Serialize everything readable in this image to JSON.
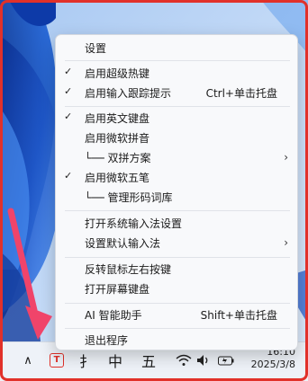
{
  "menu": {
    "items": [
      {
        "label": "设置",
        "checked": false,
        "shortcut": "",
        "submenu": false
      },
      {
        "label": "启用超级热键",
        "checked": true,
        "shortcut": "",
        "submenu": false
      },
      {
        "label": "启用输入跟踪提示",
        "checked": true,
        "shortcut": "Ctrl+单击托盘",
        "submenu": false
      },
      {
        "label": "启用英文键盘",
        "checked": true,
        "shortcut": "",
        "submenu": false
      },
      {
        "label": "启用微软拼音",
        "checked": false,
        "shortcut": "",
        "submenu": false
      },
      {
        "label": "└── 双拼方案",
        "checked": false,
        "shortcut": "",
        "submenu": true
      },
      {
        "label": "启用微软五笔",
        "checked": true,
        "shortcut": "",
        "submenu": false
      },
      {
        "label": "└── 管理形码词库",
        "checked": false,
        "shortcut": "",
        "submenu": false
      },
      {
        "label": "打开系统输入法设置",
        "checked": false,
        "shortcut": "",
        "submenu": false
      },
      {
        "label": "设置默认输入法",
        "checked": false,
        "shortcut": "",
        "submenu": true
      },
      {
        "label": "反转鼠标左右按键",
        "checked": false,
        "shortcut": "",
        "submenu": false
      },
      {
        "label": "打开屏幕键盘",
        "checked": false,
        "shortcut": "",
        "submenu": false
      },
      {
        "label": "AI 智能助手",
        "checked": false,
        "shortcut": "Shift+单击托盘",
        "submenu": false
      },
      {
        "label": "退出程序",
        "checked": false,
        "shortcut": "",
        "submenu": false
      }
    ],
    "check_glyph": "✓",
    "submenu_glyph": "›"
  },
  "taskbar": {
    "chevron_glyph": "∧",
    "tray_app_glyph": "T",
    "ime_cursor_glyph": "扌",
    "ime_mode": "中",
    "ime_wubi": "五",
    "clock_time": "16:10",
    "clock_date": "2025/3/8"
  },
  "colors": {
    "accent_red": "#e1312a",
    "arrow_pink": "#f0446a",
    "wallpaper_blue": "#1e56c8"
  }
}
